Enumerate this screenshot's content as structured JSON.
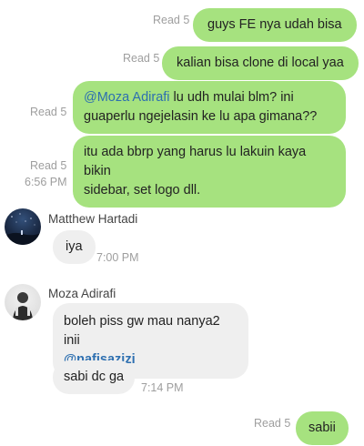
{
  "messages_out_top": [
    {
      "status": "Read 5",
      "text": "guys FE nya udah bisa"
    },
    {
      "status": "Read 5",
      "text": "kalian bisa clone di local yaa"
    },
    {
      "status": "Read 5",
      "mention": "@Moza Adirafi",
      "text_line1": " lu udh mulai blm? ini",
      "text_line2": "guaperlu ngejelasin ke lu apa gimana??"
    },
    {
      "status": "Read 5",
      "time": "6:56 PM",
      "text_line1": "itu ada bbrp yang harus lu lakuin kaya bikin",
      "text_line2": "sidebar, set logo dll."
    }
  ],
  "matthew": {
    "name": "Matthew Hartadi",
    "avatar_icon": "night-sky-avatar",
    "message": "iya",
    "time": "7:00 PM"
  },
  "moza": {
    "name": "Moza Adirafi",
    "avatar_icon": "person-avatar",
    "message1_line1": "boleh piss gw mau nanya2 inii",
    "message1_mention": "@nafisazizi",
    "message2": "sabi dc ga",
    "time": "7:14 PM"
  },
  "last_out": {
    "status": "Read 5",
    "text": "sabii"
  },
  "colors": {
    "outgoing_bubble": "#a6e27f",
    "incoming_bubble": "#efefef",
    "mention": "#2d6fb0",
    "meta_text": "#9e9e9e"
  }
}
